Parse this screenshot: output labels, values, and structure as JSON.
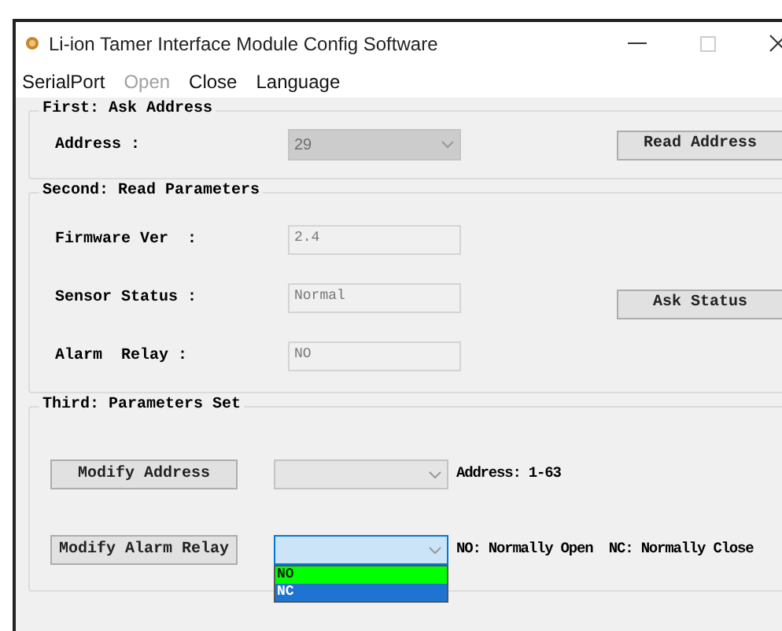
{
  "window": {
    "title": "Li-ion Tamer Interface Module Config Software"
  },
  "menu": [
    {
      "label": "SerialPort",
      "disabled": false
    },
    {
      "label": "Open",
      "disabled": true
    },
    {
      "label": "Close",
      "disabled": false
    },
    {
      "label": "Language",
      "disabled": false
    }
  ],
  "first": {
    "legend": "First: Ask Address",
    "label": "Address :",
    "value": "29",
    "button": "Read Address"
  },
  "second": {
    "legend": "Second: Read Parameters",
    "fields": [
      {
        "label": "Firmware Ver  :",
        "value": "2.4"
      },
      {
        "label": "Sensor Status :",
        "value": "Normal"
      },
      {
        "label": "Alarm  Relay :",
        "value": "NO"
      }
    ],
    "button": "Ask Status"
  },
  "third": {
    "legend": "Third: Parameters Set",
    "rows": [
      {
        "button": "Modify Address",
        "hint": "Address: 1-63",
        "focused": false,
        "options": []
      },
      {
        "button": "Modify Alarm Relay",
        "hint": "NO: Normally Open  NC: Normally Close",
        "focused": true,
        "options": [
          {
            "label": "NO",
            "color": "#00ff00"
          },
          {
            "label": "NC",
            "color": "#1e74d0"
          }
        ]
      }
    ]
  }
}
